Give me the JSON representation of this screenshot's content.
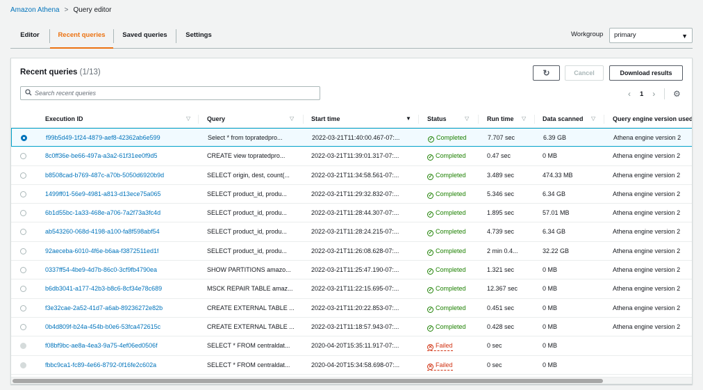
{
  "breadcrumb": {
    "root": "Amazon Athena",
    "separator": ">",
    "current": "Query editor"
  },
  "tabs": [
    {
      "label": "Editor",
      "active": false
    },
    {
      "label": "Recent queries",
      "active": true
    },
    {
      "label": "Saved queries",
      "active": false
    },
    {
      "label": "Settings",
      "active": false
    }
  ],
  "workgroup": {
    "label": "Workgroup",
    "value": "primary"
  },
  "panel": {
    "title": "Recent queries",
    "count": "(1/13)",
    "cancel_label": "Cancel",
    "download_label": "Download results",
    "search_placeholder": "Search recent queries",
    "page": "1"
  },
  "columns": {
    "execution_id": "Execution ID",
    "query": "Query",
    "start_time": "Start time",
    "status": "Status",
    "run_time": "Run time",
    "data_scanned": "Data scanned",
    "engine": "Query engine version used"
  },
  "rows": [
    {
      "id": "f99b5d49-1f24-4879-aef8-42362ab6e599",
      "query": "Select * from toprated​pro...",
      "start": "2022-03-21T11:40:00.467-07:...",
      "status": "Completed",
      "run": "7.707 sec",
      "scanned": "6.39 GB",
      "engine": "Athena engine version 2",
      "selected": true
    },
    {
      "id": "8c0ff36e-be66-497a-a3a2-61f31ee0f9d5",
      "query": "CREATE view toprated​pro...",
      "start": "2022-03-21T11:39:01.317-07:...",
      "status": "Completed",
      "run": "0.47 sec",
      "scanned": "0 MB",
      "engine": "Athena engine version 2"
    },
    {
      "id": "b8508cad-b769-487c-a70b-5050d6920b9d",
      "query": "SELECT origin, dest, count(...",
      "start": "2022-03-21T11:34:58.561-07:...",
      "status": "Completed",
      "run": "3.489 sec",
      "scanned": "474.33 MB",
      "engine": "Athena engine version 2"
    },
    {
      "id": "1499ff01-56e9-4981-a813-d13ece75a065",
      "query": "SELECT product_id, produ...",
      "start": "2022-03-21T11:29:32.832-07:...",
      "status": "Completed",
      "run": "5.346 sec",
      "scanned": "6.34 GB",
      "engine": "Athena engine version 2"
    },
    {
      "id": "6b1d55bc-1a33-468e-a706-7a2f73a3fc4d",
      "query": "SELECT product_id, produ...",
      "start": "2022-03-21T11:28:44.307-07:...",
      "status": "Completed",
      "run": "1.895 sec",
      "scanned": "57.01 MB",
      "engine": "Athena engine version 2"
    },
    {
      "id": "ab543260-068d-4198-a100-fa8f598abf54",
      "query": "SELECT product_id, produ...",
      "start": "2022-03-21T11:28:24.215-07:...",
      "status": "Completed",
      "run": "4.739 sec",
      "scanned": "6.34 GB",
      "engine": "Athena engine version 2"
    },
    {
      "id": "92aeceba-6010-4f6e-b6aa-f3872511ed1f",
      "query": "SELECT product_id, produ...",
      "start": "2022-03-21T11:26:08.628-07:...",
      "status": "Completed",
      "run": "2 min 0.4...",
      "scanned": "32.22 GB",
      "engine": "Athena engine version 2"
    },
    {
      "id": "0337ff54-4be9-4d7b-86c0-3cf9fb4790ea",
      "query": "SHOW PARTITIONS amazo...",
      "start": "2022-03-21T11:25:47.190-07:...",
      "status": "Completed",
      "run": "1.321 sec",
      "scanned": "0 MB",
      "engine": "Athena engine version 2"
    },
    {
      "id": "b6db3041-a177-42b3-b8c6-8cf34e78c689",
      "query": "MSCK REPAIR TABLE amaz...",
      "start": "2022-03-21T11:22:15.695-07:...",
      "status": "Completed",
      "run": "12.367 sec",
      "scanned": "0 MB",
      "engine": "Athena engine version 2"
    },
    {
      "id": "f3e32cae-2a52-41d7-a6ab-89236272e82b",
      "query": "CREATE EXTERNAL TABLE ...",
      "start": "2022-03-21T11:20:22.853-07:...",
      "status": "Completed",
      "run": "0.451 sec",
      "scanned": "0 MB",
      "engine": "Athena engine version 2"
    },
    {
      "id": "0b4d809f-b24a-454b-b0e6-53fca472615c",
      "query": "CREATE EXTERNAL TABLE ...",
      "start": "2022-03-21T11:18:57.943-07:...",
      "status": "Completed",
      "run": "0.428 sec",
      "scanned": "0 MB",
      "engine": "Athena engine version 2"
    },
    {
      "id": "f08bf9bc-ae8a-4ea3-9a75-4ef06ed0506f",
      "query": "SELECT * FROM centraldat...",
      "start": "2020-04-20T15:35:11.917-07:...",
      "status": "Failed",
      "run": "0 sec",
      "scanned": "0 MB",
      "engine": "",
      "disabled": true
    },
    {
      "id": "fbbc9ca1-fc89-4e66-8792-0f16fe2c602a",
      "query": "SELECT * FROM centraldat...",
      "start": "2020-04-20T15:34:58.698-07:...",
      "status": "Failed",
      "run": "0 sec",
      "scanned": "0 MB",
      "engine": "",
      "disabled": true
    }
  ]
}
